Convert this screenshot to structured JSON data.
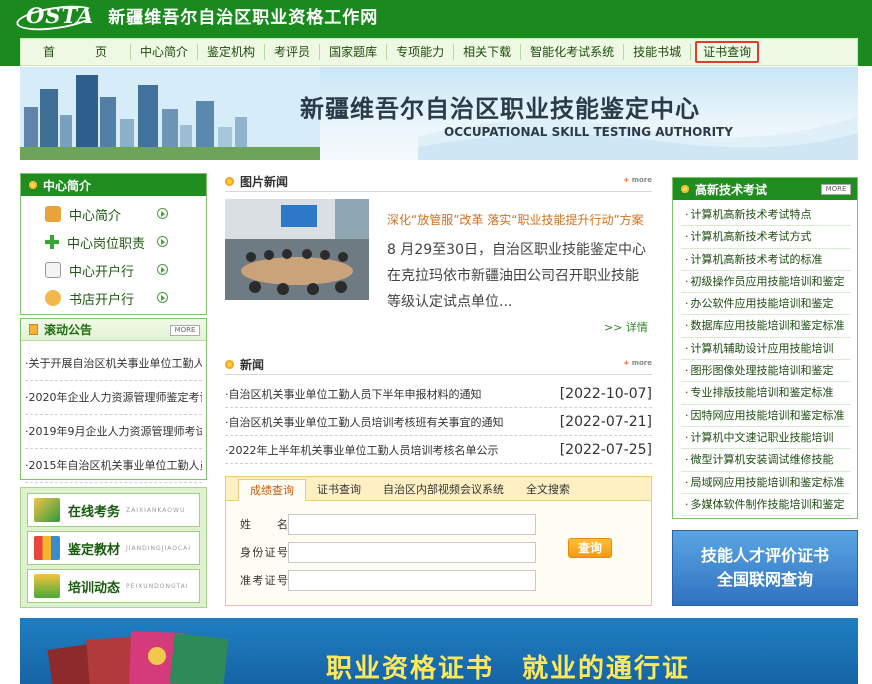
{
  "site": {
    "logo_text": "OSTA",
    "title": "新疆维吾尔自治区职业资格工作网"
  },
  "nav": {
    "items": [
      {
        "label": "首　页"
      },
      {
        "label": "中心简介"
      },
      {
        "label": "鉴定机构"
      },
      {
        "label": "考评员"
      },
      {
        "label": "国家题库"
      },
      {
        "label": "专项能力"
      },
      {
        "label": "相关下载"
      },
      {
        "label": "智能化考试系统"
      },
      {
        "label": "技能书城"
      },
      {
        "label": "证书查询"
      }
    ]
  },
  "banner": {
    "title": "新疆维吾尔自治区职业技能鉴定中心",
    "subtitle": "OCCUPATIONAL SKILL TESTING AUTHORITY"
  },
  "center_intro": {
    "heading": "中心简介",
    "items": [
      {
        "label": "中心简介",
        "icon": "building-icon"
      },
      {
        "label": "中心岗位职责",
        "icon": "plus-cross-icon"
      },
      {
        "label": "中心开户行",
        "icon": "document-icon"
      },
      {
        "label": "书店开户行",
        "icon": "person-icon"
      }
    ]
  },
  "notices": {
    "heading": "滚动公告",
    "more": "MORE",
    "items": [
      "·关于开展自治区机关事业单位工勤人员",
      "·2020年企业人力资源管理师鉴定考试",
      "·2019年9月企业人力资源管理师考试",
      "·2015年自治区机关事业单位工勤人员"
    ]
  },
  "quick_links": [
    {
      "label": "在线考务",
      "pinyin": "ZAIXIANKAOWU"
    },
    {
      "label": "鉴定教材",
      "pinyin": "JIANDINGJIAOCAI"
    },
    {
      "label": "培训动态",
      "pinyin": "PEIXUNDONGTAI"
    }
  ],
  "photo_news": {
    "heading": "图片新闻",
    "more": "more",
    "headline": "深化“放管服”改革 落实“职业技能提升行动”方案",
    "body": "8 月29至30日，自治区职业技能鉴定中心在克拉玛依市新疆油田公司召开职业技能等级认定试点单位...",
    "detail": ">> 详情"
  },
  "news": {
    "heading": "新闻",
    "more": "more",
    "items": [
      {
        "title": "·自治区机关事业单位工勤人员下半年申报材料的通知",
        "date": "[2022-10-07]"
      },
      {
        "title": "·自治区机关事业单位工勤人员培训考核班有关事宜的通知",
        "date": "[2022-07-21]"
      },
      {
        "title": "·2022年上半年机关事业单位工勤人员培训考核名单公示",
        "date": "[2022-07-25]"
      }
    ]
  },
  "query": {
    "tabs": [
      "成绩查询",
      "证书查询",
      "自治区内部视频会议系统",
      "全文搜索"
    ],
    "active_tab": 0,
    "fields": [
      {
        "label": "姓名",
        "value": ""
      },
      {
        "label": "身份证号",
        "value": ""
      },
      {
        "label": "准考证号",
        "value": ""
      }
    ],
    "submit": "查询"
  },
  "tech_exam": {
    "heading": "高新技术考试",
    "more": "MORE",
    "items": [
      "计算机高新技术考试特点",
      "计算机高新技术考试方式",
      "计算机高新技术考试的标准",
      "初级操作员应用技能培训和鉴定",
      "办公软件应用技能培训和鉴定",
      "数据库应用技能培训和鉴定标准",
      "计算机辅助设计应用技能培训",
      "图形图像处理技能培训和鉴定",
      "专业排版技能培训和鉴定标准",
      "因特网应用技能培训和鉴定标准",
      "计算机中文速记职业技能培训",
      "微型计算机安装调试维修技能",
      "局域网应用技能培训和鉴定标准",
      "多媒体软件制作技能培训和鉴定"
    ]
  },
  "verify_banner": {
    "line1": "技能人才评价证书",
    "line2": "全国联网查询"
  },
  "bottom_banner": {
    "text": "职业资格证书　就业的通行证"
  },
  "colors": {
    "brand_green": "#1b8a1e",
    "highlight_red": "#e23a2b",
    "accent_orange": "#d2701f"
  }
}
